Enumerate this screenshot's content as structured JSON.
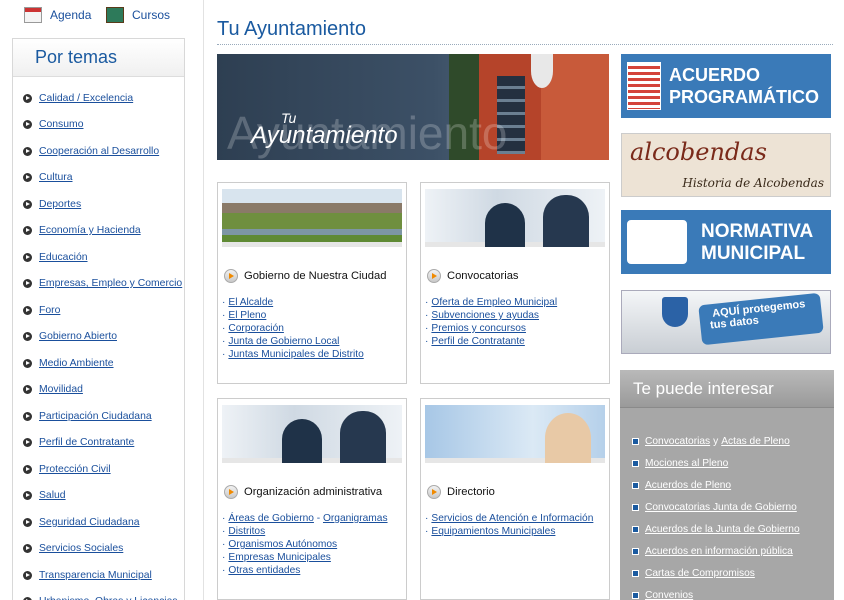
{
  "top_links": {
    "agenda": "Agenda",
    "cursos": "Cursos"
  },
  "sidebar": {
    "title": "Por temas",
    "items": [
      "Calidad / Excelencia",
      "Consumo",
      "Cooperación al Desarrollo",
      "Cultura",
      "Deportes",
      "Economía y Hacienda",
      "Educación",
      "Empresas, Empleo y Comercio",
      "Foro",
      "Gobierno Abierto",
      "Medio Ambiente",
      "Movilidad",
      "Participación Ciudadana",
      "Perfil de Contratante",
      "Protección Civil",
      "Salud",
      "Seguridad Ciudadana",
      "Servicios Sociales",
      "Transparencia Municipal",
      "Urbanismo, Obras y Licencias"
    ]
  },
  "main": {
    "title": "Tu Ayuntamiento",
    "hero": {
      "small": "Tu",
      "big": "Ayuntamiento",
      "ghost": "Ayuntamiento"
    }
  },
  "boxes": [
    {
      "heading": "Gobierno de Nuestra Ciudad",
      "links": [
        "El  Alcalde",
        "El Pleno",
        "Corporación",
        "Junta de Gobierno Local",
        "Juntas Municipales de Distrito"
      ]
    },
    {
      "heading": "Convocatorias",
      "links": [
        "Oferta de Empleo Municipal",
        "Subvenciones y ayudas",
        "Premios y concursos",
        "Perfil de Contratante"
      ]
    },
    {
      "heading": "Organización administrativa",
      "links": [
        [
          "Áreas de Gobierno",
          " - ",
          "Organigramas"
        ],
        "Distritos",
        "Organismos Autónomos",
        "Empresas Municipales",
        "Otras entidades"
      ]
    },
    {
      "heading": "Directorio",
      "links": [
        "Servicios de Atención e Información",
        "Equipamientos Municipales"
      ]
    }
  ],
  "banners": {
    "acuerdo": {
      "line1": "ACUERDO",
      "line2": "PROGRAMÁTICO"
    },
    "alcobendas": {
      "line1": "alcobendas",
      "line2": "Historia de Alcobendas"
    },
    "normativa": {
      "line1": "NORMATIVA",
      "line2": "MUNICIPAL"
    },
    "datos": {
      "line1": "AQUÍ protegemos",
      "line2": "tus datos"
    }
  },
  "interest": {
    "title": "Te puede interesar",
    "items": [
      [
        "Convocatorias",
        " y ",
        "Actas de Pleno"
      ],
      "Mociones al Pleno",
      "Acuerdos de Pleno",
      "Convocatorias Junta de Gobierno",
      "Acuerdos de la Junta de Gobierno",
      "Acuerdos en información pública",
      "Cartas de Compromisos",
      "Convenios"
    ]
  }
}
